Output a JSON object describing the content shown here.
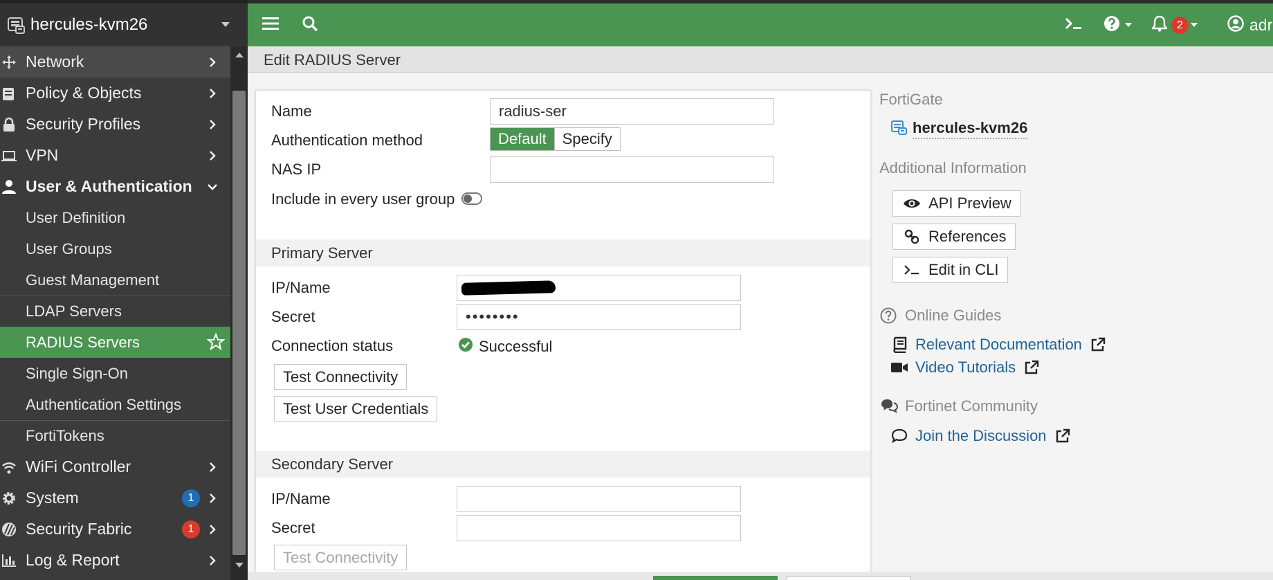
{
  "device": {
    "name": "hercules-kvm26"
  },
  "nav": {
    "items": [
      {
        "label": "Network",
        "icon": "network-icon"
      },
      {
        "label": "Policy & Objects",
        "icon": "policy-icon"
      },
      {
        "label": "Security Profiles",
        "icon": "lock-icon"
      },
      {
        "label": "VPN",
        "icon": "laptop-icon"
      },
      {
        "label": "User & Authentication",
        "icon": "user-icon"
      },
      {
        "label": "WiFi Controller",
        "icon": "wifi-icon"
      },
      {
        "label": "System",
        "icon": "gear-icon",
        "badge": "1"
      },
      {
        "label": "Security Fabric",
        "icon": "fabric-icon",
        "badge": "1"
      },
      {
        "label": "Log & Report",
        "icon": "chart-icon"
      }
    ],
    "sub_items": [
      {
        "label": "User Definition"
      },
      {
        "label": "User Groups"
      },
      {
        "label": "Guest Management"
      },
      {
        "label": "LDAP Servers"
      },
      {
        "label": "RADIUS Servers"
      },
      {
        "label": "Single Sign-On"
      },
      {
        "label": "Authentication Settings"
      },
      {
        "label": "FortiTokens"
      }
    ]
  },
  "topbar": {
    "notification_count": "2",
    "user_label": "adr"
  },
  "page": {
    "title": "Edit RADIUS Server"
  },
  "form": {
    "name_label": "Name",
    "name_value": "radius-ser",
    "auth_method_label": "Authentication method",
    "auth_default": "Default",
    "auth_specify": "Specify",
    "nas_ip_label": "NAS IP",
    "nas_ip_value": "",
    "include_label": "Include in every user group",
    "primary": {
      "title": "Primary Server",
      "ip_label": "IP/Name",
      "secret_label": "Secret",
      "secret_value": "••••••••",
      "conn_label": "Connection status",
      "conn_value": "Successful",
      "test_conn": "Test Connectivity",
      "test_user": "Test User Credentials"
    },
    "secondary": {
      "title": "Secondary Server",
      "ip_label": "IP/Name",
      "ip_value": "",
      "secret_label": "Secret",
      "secret_value": "",
      "test_conn": "Test Connectivity"
    }
  },
  "info": {
    "fortigate_head": "FortiGate",
    "device_name": "hercules-kvm26",
    "additional_head": "Additional Information",
    "api_preview": "API Preview",
    "references": "References",
    "edit_cli": "Edit in CLI",
    "guides_head": "Online Guides",
    "relevant_doc": "Relevant Documentation",
    "video_tut": "Video Tutorials",
    "community_head": "Fortinet Community",
    "join_disc": "Join the Discussion"
  },
  "colors": {
    "accent": "#4a9551",
    "sidebar": "#3b3b3b",
    "link": "#1f6399",
    "badge_red": "#d83b2b",
    "badge_blue": "#1f6fb5"
  }
}
